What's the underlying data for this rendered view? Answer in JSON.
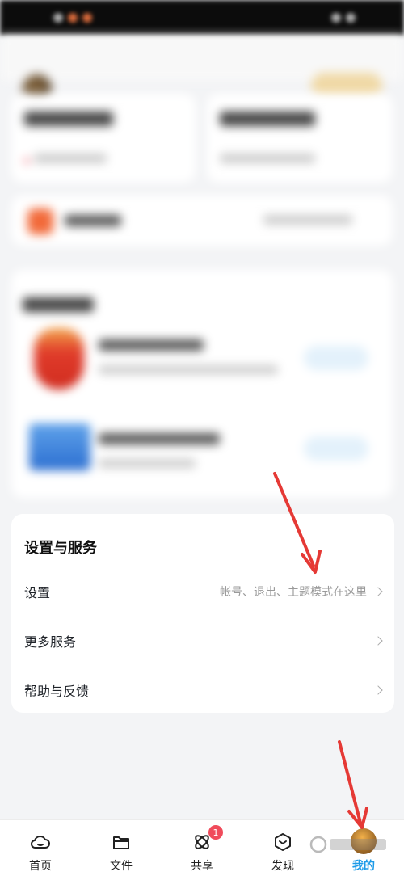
{
  "settings_section": {
    "title": "设置与服务",
    "items": [
      {
        "label": "设置",
        "hint": "帐号、退出、主题模式在这里"
      },
      {
        "label": "更多服务",
        "hint": ""
      },
      {
        "label": "帮助与反馈",
        "hint": ""
      }
    ]
  },
  "tab_bar": {
    "tabs": [
      {
        "label": "首页",
        "icon": "cloud-icon"
      },
      {
        "label": "文件",
        "icon": "folder-icon"
      },
      {
        "label": "共享",
        "icon": "atom-icon",
        "badge": "1"
      },
      {
        "label": "发现",
        "icon": "cube-icon"
      },
      {
        "label": "我的",
        "icon": "avatar"
      }
    ],
    "active": "我的"
  },
  "colors": {
    "accent": "#1e9be8",
    "annotation_arrow": "#e53935"
  }
}
